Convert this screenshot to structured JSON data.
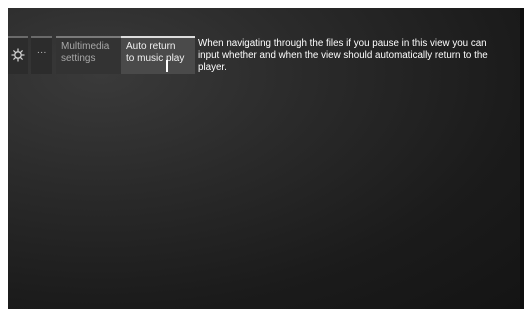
{
  "breadcrumb": {
    "items": [
      {
        "icon": "gear-icon"
      },
      {
        "label": "..."
      },
      {
        "label_line1": "Multimedia",
        "label_line2": "settings"
      },
      {
        "label_line1": "Auto return",
        "label_line2": "to music play"
      }
    ]
  },
  "help_text": "When navigating through the files if you pause in this view you can input whether and when the view should automatically return to the player.",
  "colors": {
    "background": "#1b1b1b",
    "active_tab": "#4a4a4a",
    "active_border": "#dcdcdc",
    "text": "#ffffff"
  }
}
